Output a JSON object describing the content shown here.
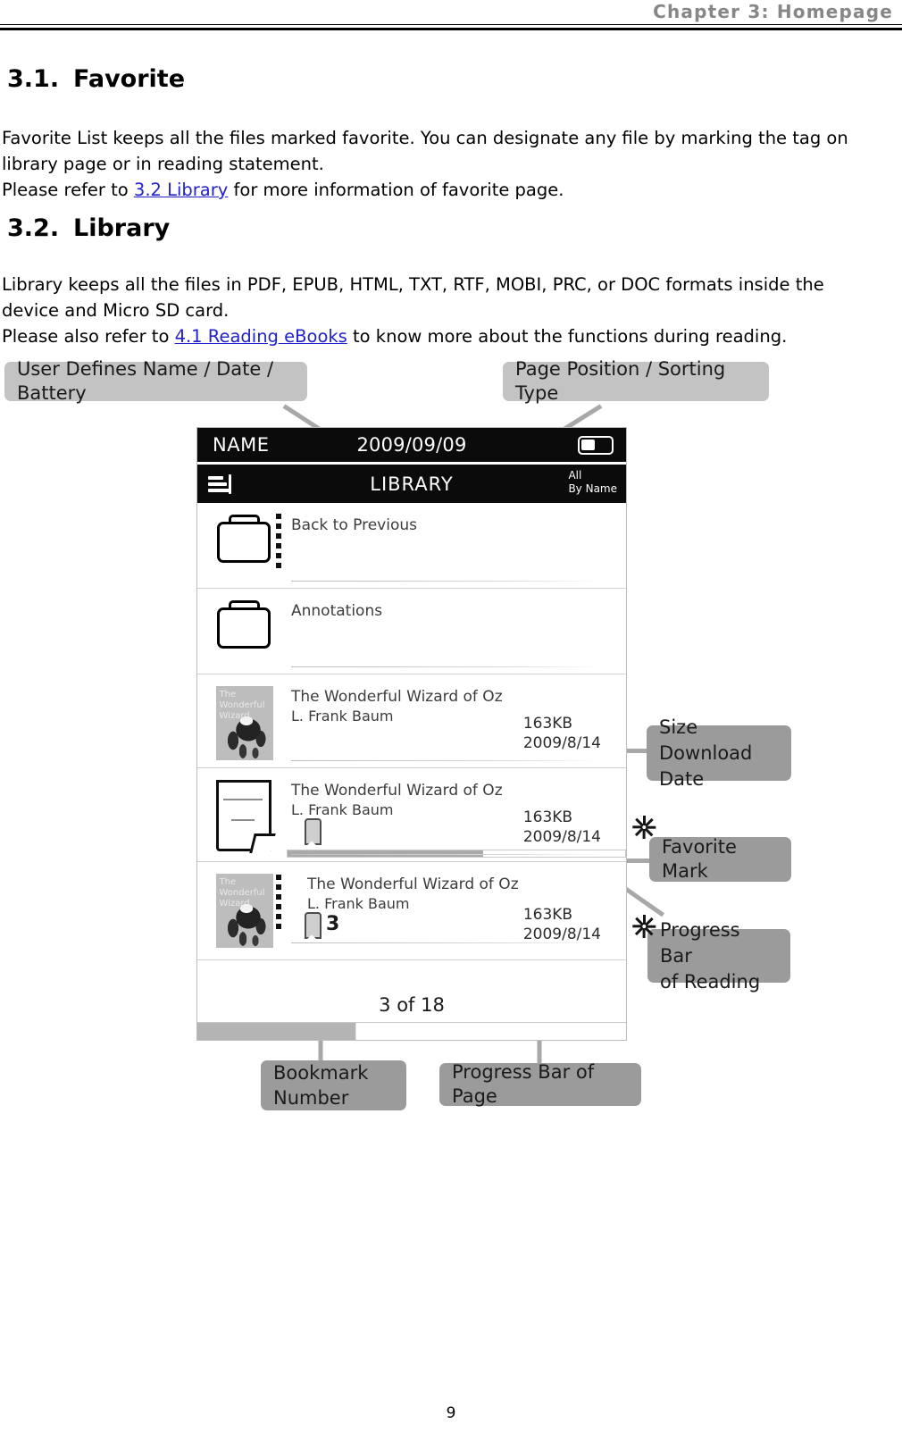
{
  "header": {
    "chapter_title": "Chapter 3: Homepage"
  },
  "sections": [
    {
      "number": "3.1.",
      "title": "Favorite",
      "paragraph_parts": [
        {
          "type": "text",
          "text": "Favorite List keeps all the files marked favorite. You can designate any file by marking the tag on library page or in reading statement."
        },
        {
          "type": "break"
        },
        {
          "type": "text",
          "text": "Please refer to "
        },
        {
          "type": "link",
          "text": "3.2 Library"
        },
        {
          "type": "text",
          "text": " for more information of favorite page."
        }
      ]
    },
    {
      "number": "3.2.",
      "title": "Library",
      "paragraph_parts": [
        {
          "type": "text",
          "text": "Library keeps all the files in PDF, EPUB, HTML, TXT, RTF, MOBI, PRC, or DOC formats inside the device and Micro SD card."
        },
        {
          "type": "break"
        },
        {
          "type": "text",
          "text": "Please also refer to "
        },
        {
          "type": "link",
          "text": "4.1 Reading eBooks"
        },
        {
          "type": "text",
          "text": " to know more about the functions during reading."
        }
      ]
    }
  ],
  "paragraph_text": {
    "p1_line1": "Favorite List keeps all the files marked favorite. You can designate any file by marking the tag on",
    "p1_line2": "library page or in reading statement.",
    "p1_line3_pre": "Please refer to ",
    "p1_link": "3.2 Library",
    "p1_line3_post": " for more information of favorite page.",
    "p2_line1": "Library keeps all the files in PDF, EPUB, HTML, TXT, RTF, MOBI, PRC, or DOC formats inside the",
    "p2_line2": "device and Micro SD card.",
    "p2_line3_pre": "Please also refer to ",
    "p2_link": "4.1 Reading eBooks",
    "p2_line3_post": " to know more about the functions during reading."
  },
  "diagram": {
    "callouts": {
      "user_defines": "User Defines Name / Date / Battery",
      "page_position": "Page Position / Sorting Type",
      "size_download": "Size\nDownload Date",
      "favorite_mark": "Favorite Mark",
      "progress_reading": "Progress Bar\nof Reading",
      "bookmark_number": "Bookmark\nNumber",
      "progress_page": "Progress Bar of Page"
    },
    "device": {
      "status_name": "NAME",
      "status_date": "2009/09/09",
      "battery_icon": "battery-icon",
      "menu_icon": "list-menu-icon",
      "screen_title": "LIBRARY",
      "sort_scope": "All",
      "sort_order": "By Name",
      "rows": [
        {
          "kind": "folder",
          "icon": "folder-icon",
          "label": "Back to Previous",
          "has_dots": true
        },
        {
          "kind": "folder",
          "icon": "folder-icon",
          "label": "Annotations",
          "has_dots": false
        },
        {
          "kind": "book",
          "cover": "closed-cover-thumbnail",
          "title": "The  Wonderful Wizard of Oz",
          "author": "L. Frank Baum",
          "size": "163KB",
          "date": "2009/8/14",
          "bookmark": null,
          "favorite": false,
          "progress_percent": 0,
          "has_dots": false
        },
        {
          "kind": "book",
          "cover": "open-book-thumbnail",
          "title": "The  Wonderful Wizard of Oz",
          "author": "L. Frank Baum",
          "size": "163KB",
          "date": "2009/8/14",
          "bookmark": "",
          "favorite": true,
          "progress_percent": 58,
          "has_dots": false
        },
        {
          "kind": "book",
          "cover": "closed-cover-thumbnail",
          "title": "The  Wonderful Wizard of Oz",
          "author": "L. Frank Baum",
          "size": "163KB",
          "date": "2009/8/14",
          "bookmark": "3",
          "favorite": true,
          "progress_percent": 0,
          "has_dots": true
        }
      ],
      "page_indicator": "3 of 18",
      "page_progress_percent": 37
    }
  },
  "footer": {
    "page_number": "9"
  },
  "colors": {
    "callout_bg": "#c3c3c3",
    "callout_bg_dark": "#9b9b9b",
    "link": "#2222cc",
    "header_gray": "#878787",
    "device_bar": "#0b0b0b",
    "progress_fill": "#a9a9a9"
  }
}
